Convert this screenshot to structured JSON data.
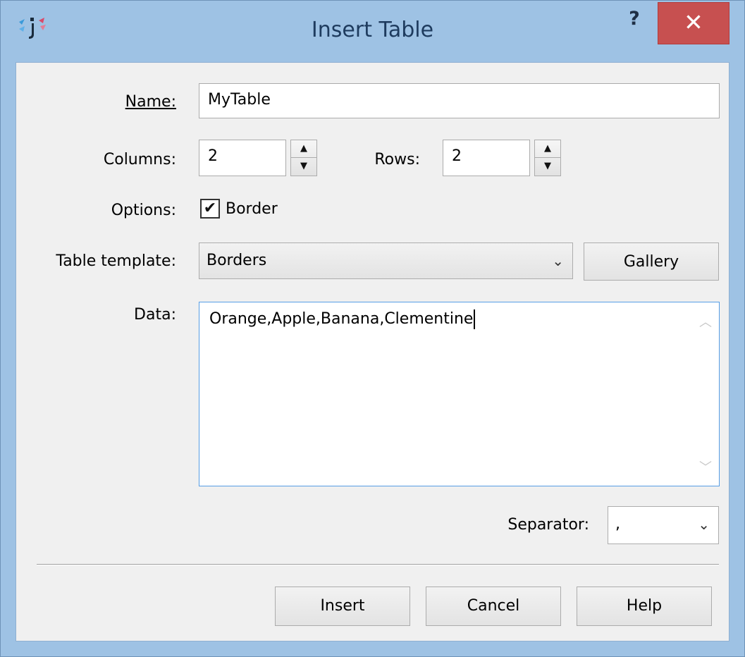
{
  "window": {
    "title": "Insert Table",
    "help_glyph": "?",
    "close_glyph": "✕"
  },
  "form": {
    "name_label": "Name:",
    "name_value": "MyTable",
    "columns_label": "Columns:",
    "columns_value": "2",
    "rows_label": "Rows:",
    "rows_value": "2",
    "options_label": "Options:",
    "border_label": "Border",
    "border_checked": true,
    "template_label": "Table template:",
    "template_value": "Borders",
    "gallery_label": "Gallery",
    "data_label": "Data:",
    "data_value": "Orange,Apple,Banana,Clementine",
    "separator_label": "Separator:",
    "separator_value": ","
  },
  "buttons": {
    "insert": "Insert",
    "cancel": "Cancel",
    "help": "Help"
  },
  "icons": {
    "app": "app-logo-icon",
    "spin_up": "up-arrow-icon",
    "spin_down": "down-arrow-icon",
    "dropdown": "chevron-down-icon"
  },
  "colors": {
    "titlebar": "#9ec2e4",
    "close": "#c75050"
  }
}
